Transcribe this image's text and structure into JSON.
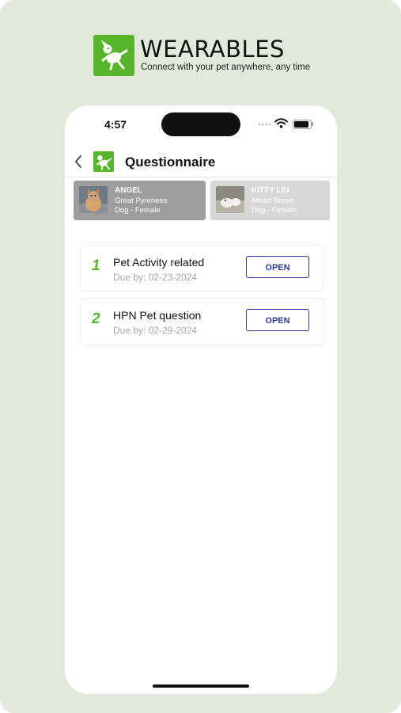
{
  "brand": {
    "name": "WEARABLES",
    "tagline": "Connect with your pet anywhere, any time",
    "accent_color": "#57b52a"
  },
  "status_bar": {
    "time": "4:57"
  },
  "nav": {
    "title": "Questionnaire",
    "back_icon": "chevron-left-icon"
  },
  "pets": [
    {
      "name": "ANGEL",
      "breed": "Great Pyrenees",
      "type": "Dog - Female",
      "selected": true
    },
    {
      "name": "KITTY LIU",
      "breed": "Mixed Breed",
      "type": "Dog - Female",
      "selected": false
    }
  ],
  "questionnaires": [
    {
      "number": "1",
      "title": "Pet Activity related",
      "due": "Due by: 02-23-2024",
      "action": "OPEN"
    },
    {
      "number": "2",
      "title": "HPN Pet question",
      "due": "Due by: 02-29-2024",
      "action": "OPEN"
    }
  ]
}
